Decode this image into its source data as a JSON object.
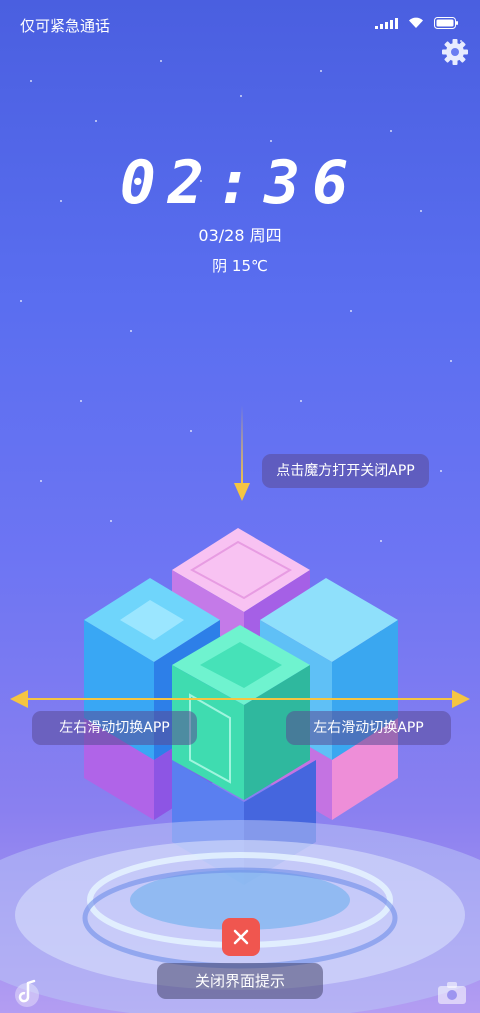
{
  "status_bar": {
    "carrier": "仅可紧急通话",
    "icons": [
      "signal-icon",
      "wifi-icon",
      "battery-icon"
    ]
  },
  "settings_icon": "gear-icon",
  "lock_screen": {
    "time": "02:36",
    "date": "03/28 周四",
    "weather": "阴 15℃"
  },
  "hints": {
    "top": "点击魔方打开关闭APP",
    "left": "左右滑动切换APP",
    "right": "左右滑动切换APP",
    "close": "关闭界面提示"
  },
  "colors": {
    "arrow": "#f5c542",
    "close_button": "#f0564f",
    "cube_green": "#3fe0b5",
    "cube_blue": "#38a8f5",
    "cube_pink": "#f4a8ea",
    "cube_purple": "#a45ef0"
  },
  "bottom_icons": {
    "left": "music-note-icon",
    "right": "camera-icon"
  }
}
